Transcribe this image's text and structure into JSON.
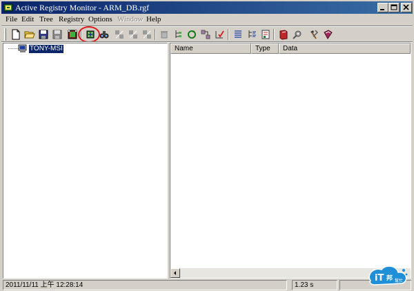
{
  "window": {
    "title": "Active Registry Monitor - ARM_DB.rgf",
    "controls": [
      "minimize",
      "maximize",
      "close"
    ]
  },
  "menubar": {
    "items": [
      {
        "label": "File",
        "enabled": true
      },
      {
        "label": "Edit",
        "enabled": true
      },
      {
        "label": "Tree",
        "enabled": true
      },
      {
        "label": "Registry",
        "enabled": true
      },
      {
        "label": "Options",
        "enabled": true
      },
      {
        "label": "Window",
        "enabled": false
      },
      {
        "label": "Help",
        "enabled": true
      }
    ]
  },
  "toolbar": {
    "buttons": [
      {
        "icon": "new-document-icon"
      },
      {
        "icon": "open-folder-icon"
      },
      {
        "icon": "save-icon"
      },
      {
        "icon": "save-disabled-icon",
        "enabled": false
      },
      {
        "icon": "film-scan-icon"
      },
      {
        "icon": "registry-scan-icon",
        "highlighted": true
      },
      {
        "icon": "binoculars-find-icon"
      },
      {
        "icon": "compare-disabled-icon",
        "enabled": false
      },
      {
        "icon": "compare-next-disabled-icon",
        "enabled": false
      },
      {
        "icon": "compare-prev-disabled-icon",
        "enabled": false
      },
      {
        "icon": "delete-disabled-icon",
        "enabled": false
      },
      {
        "icon": "tree-branch-icon"
      },
      {
        "icon": "refresh-tree-icon"
      },
      {
        "icon": "move-tree-icon"
      },
      {
        "icon": "tree-check-icon"
      },
      {
        "icon": "list-lines-icon"
      },
      {
        "icon": "list-tree-icon"
      },
      {
        "icon": "report-icon"
      },
      {
        "icon": "red-book-icon"
      },
      {
        "icon": "tools-gear-icon"
      },
      {
        "icon": "wrench-hammer-icon"
      },
      {
        "icon": "help-book-icon"
      }
    ],
    "highlight_color": "#e01b1b"
  },
  "tree": {
    "root": {
      "label": "TONY-MSI",
      "icon": "computer-icon",
      "selected": true
    }
  },
  "list": {
    "columns": [
      "Name",
      "Type",
      "Data"
    ],
    "rows": []
  },
  "statusbar": {
    "timestamp": "2011/11/11 上午 12:28:14",
    "elapsed": "1.23 s"
  },
  "watermark": {
    "text": "iT邦幫忙",
    "color": "#1f8fd8"
  },
  "colors": {
    "title_active": "#0a246a",
    "face": "#d4d0c8",
    "selection": "#0a246a"
  }
}
